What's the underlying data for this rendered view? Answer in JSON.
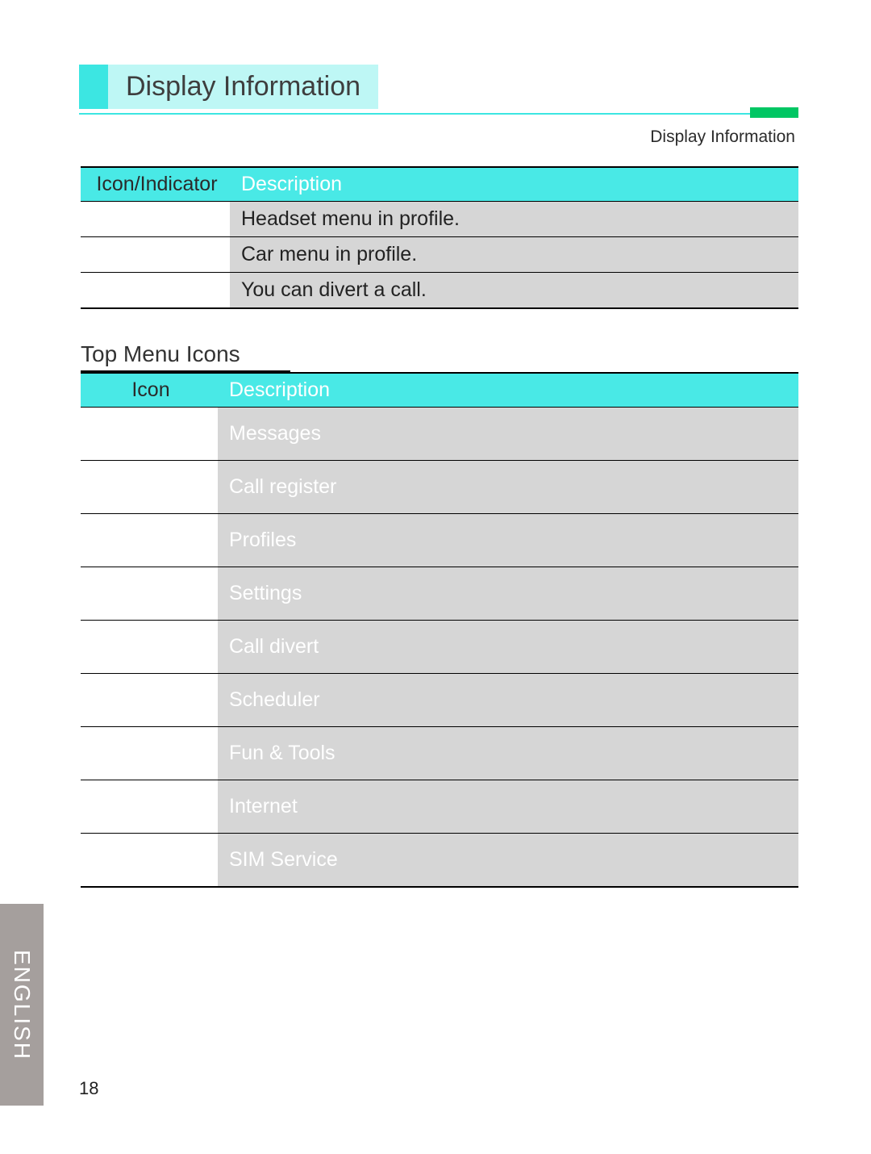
{
  "title": "Display Information",
  "subheading": "Display Information",
  "side_tab": "ENGLISH",
  "page_number": "18",
  "table1": {
    "head_icon": "Icon/Indicator",
    "head_desc": "Description",
    "rows": [
      "Headset menu in profile.",
      "Car menu in profile.",
      "You can divert a call."
    ]
  },
  "section_heading": "Top Menu Icons",
  "table2": {
    "head_icon": "Icon",
    "head_desc": "Description",
    "rows": [
      "Messages",
      "Call register",
      "Profiles",
      "Settings",
      "Call divert",
      "Scheduler",
      "Fun & Tools",
      "Internet",
      "SIM Service"
    ]
  }
}
